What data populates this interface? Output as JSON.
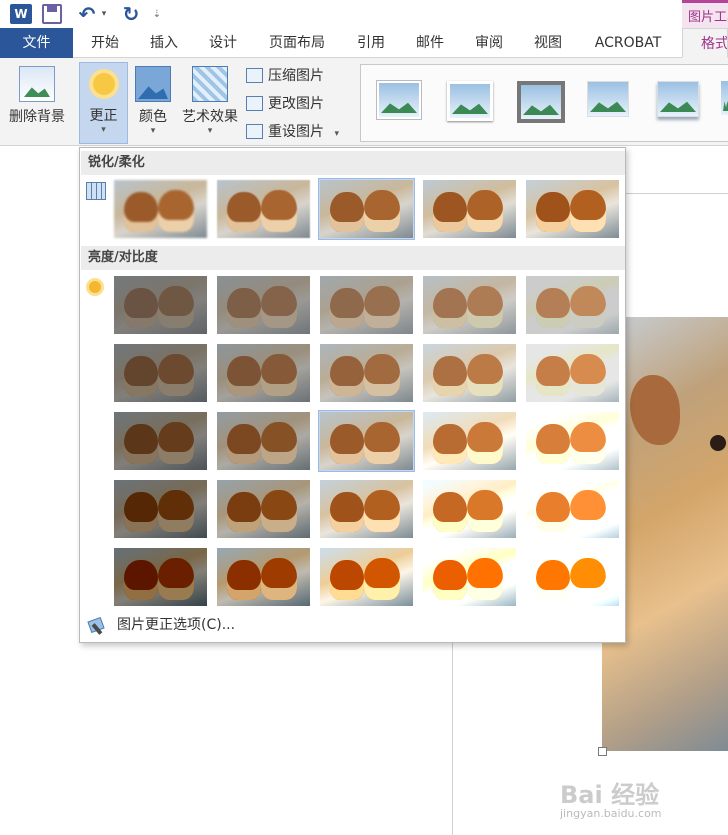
{
  "qat": {
    "app_logo": "W",
    "undo_glyph": "↶",
    "redo_glyph": "↻",
    "dropdown_glyph": "▾",
    "more_glyph": "⇣",
    "context_tab_group": "图片工具"
  },
  "tabs": [
    {
      "label": "文件"
    },
    {
      "label": "开始"
    },
    {
      "label": "插入"
    },
    {
      "label": "设计"
    },
    {
      "label": "页面布局"
    },
    {
      "label": "引用"
    },
    {
      "label": "邮件"
    },
    {
      "label": "审阅"
    },
    {
      "label": "视图"
    },
    {
      "label": "ACROBAT"
    },
    {
      "label": "格式"
    }
  ],
  "ribbon": {
    "remove_background": "删除背景",
    "corrections": "更正",
    "color": "颜色",
    "artistic_effects": "艺术效果",
    "compress": "压缩图片",
    "change_picture": "更改图片",
    "reset_picture": "重设图片",
    "dropdown_glyph": "▾"
  },
  "gallery": {
    "section_sharpen": "锐化/柔化",
    "section_brightness": "亮度/对比度",
    "footer": "图片更正选项(C)..."
  },
  "watermark": {
    "brand": "Bai  经验",
    "url": "jingyan.baidu.com"
  },
  "colors": {
    "file_tab": "#2b579a",
    "accent": "#a0338a",
    "selection": "#c5d7ee"
  }
}
